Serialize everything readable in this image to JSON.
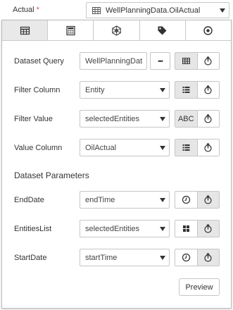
{
  "field_label": "Actual",
  "required_mark": "*",
  "source_select": {
    "value": "WellPlanningData.OilActual",
    "icon": "table-icon"
  },
  "tabs": [
    {
      "icon": "table-icon",
      "active": true
    },
    {
      "icon": "calculator-icon",
      "active": false
    },
    {
      "icon": "network-icon",
      "active": false
    },
    {
      "icon": "tag-icon",
      "active": false
    },
    {
      "icon": "target-icon",
      "active": false
    }
  ],
  "dataset_query": {
    "label": "Dataset Query",
    "value": "WellPlanningDat",
    "more_label": "•••"
  },
  "filter_column": {
    "label": "Filter Column",
    "value": "Entity"
  },
  "filter_value": {
    "label": "Filter Value",
    "value": "selectedEntities",
    "mode_label": "ABC"
  },
  "value_column": {
    "label": "Value Column",
    "value": "OilActual"
  },
  "parameters_title": "Dataset Parameters",
  "parameters": [
    {
      "label": "EndDate",
      "value": "endTime",
      "icon": "clock-icon"
    },
    {
      "label": "EntitiesList",
      "value": "selectedEntities",
      "icon": "grid-icon"
    },
    {
      "label": "StartDate",
      "value": "startTime",
      "icon": "clock-icon"
    }
  ],
  "preview_label": "Preview"
}
